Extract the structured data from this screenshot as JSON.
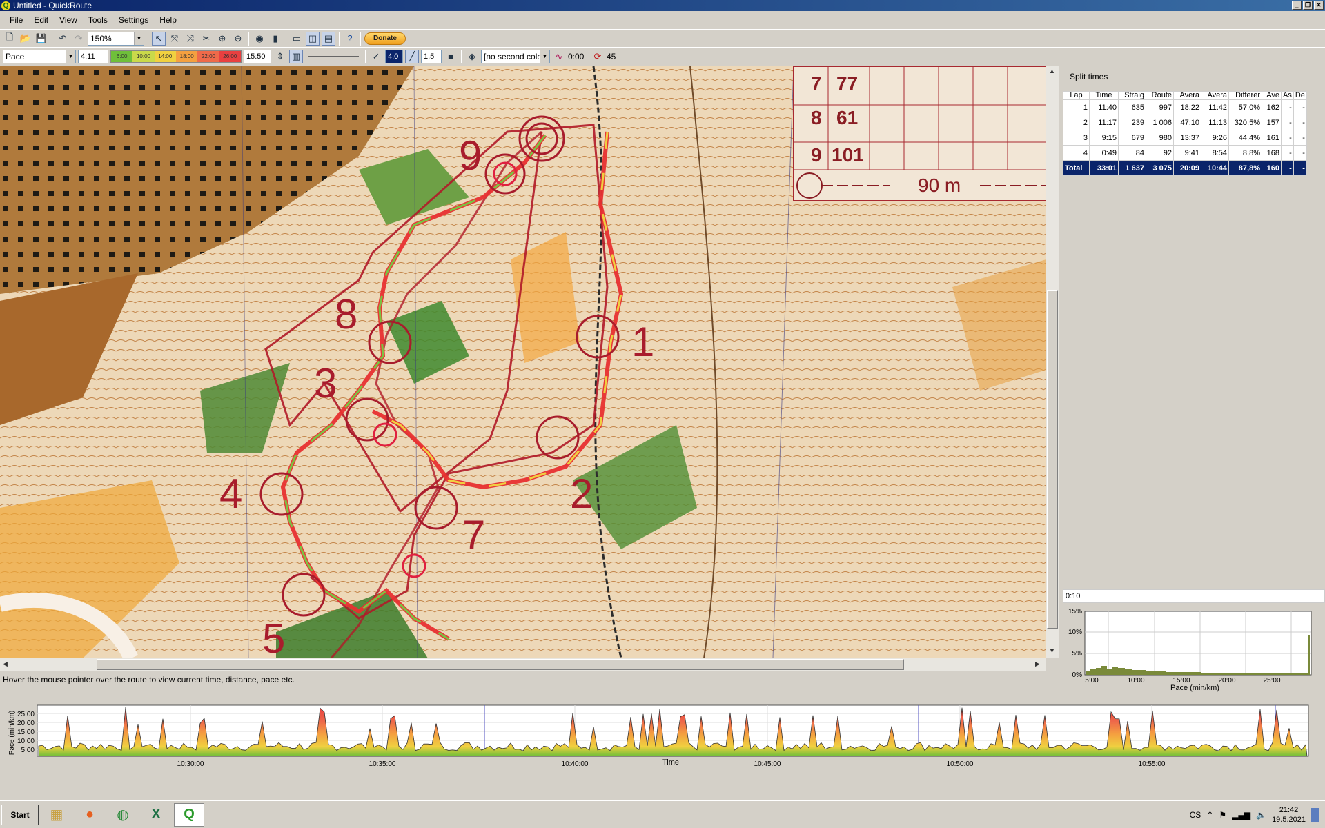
{
  "window": {
    "title": "Untitled - QuickRoute"
  },
  "menu": [
    "File",
    "Edit",
    "View",
    "Tools",
    "Settings",
    "Help"
  ],
  "toolbar": {
    "zoom": "150%",
    "donate": "Donate"
  },
  "toolbar2": {
    "property": "Pace",
    "min_value": "4:11",
    "scale_labels": [
      "6:00",
      "10:00",
      "14:00",
      "18:00",
      "22:00",
      "26:00"
    ],
    "max_value": "15:50",
    "width_value": "1,5",
    "second_color": "[no second color",
    "time_offset": "0:00",
    "smoothing": "45"
  },
  "map": {
    "legend_rows": [
      [
        "7",
        "77"
      ],
      [
        "8",
        "61"
      ],
      [
        "9",
        "101"
      ]
    ],
    "scale_text": "90 m",
    "controls": [
      "1",
      "2",
      "3",
      "4",
      "5",
      "7",
      "8",
      "9"
    ]
  },
  "status": "Hover the mouse pointer over the route to view current time, distance, pace etc.",
  "splits": {
    "title": "Split times",
    "headers": [
      "Lap",
      "Time",
      "Straig",
      "Route",
      "Avera",
      "Avera",
      "Differer",
      "Ave",
      "As",
      "De"
    ],
    "rows": [
      [
        "1",
        "11:40",
        "635",
        "997",
        "18:22",
        "11:42",
        "57,0%",
        "162",
        "-",
        "-"
      ],
      [
        "2",
        "11:17",
        "239",
        "1 006",
        "47:10",
        "11:13",
        "320,5%",
        "157",
        "-",
        "-"
      ],
      [
        "3",
        "9:15",
        "679",
        "980",
        "13:37",
        "9:26",
        "44,4%",
        "161",
        "-",
        "-"
      ],
      [
        "4",
        "0:49",
        "84",
        "92",
        "9:41",
        "8:54",
        "8,8%",
        "168",
        "-",
        "-"
      ]
    ],
    "total": [
      "Total",
      "33:01",
      "1 637",
      "3 075",
      "20:09",
      "10:44",
      "87,8%",
      "160",
      "-",
      "-"
    ]
  },
  "histogram": {
    "duration": "0:10",
    "y_ticks": [
      "15%",
      "10%",
      "5%",
      "0%"
    ],
    "x_ticks": [
      "5:00",
      "10:00",
      "15:00",
      "20:00",
      "25:00"
    ],
    "x_label": "Pace (min/km)"
  },
  "line_graph": {
    "y_label": "Pace (min/km)",
    "y_ticks": [
      "25:00",
      "20:00",
      "15:00",
      "10:00",
      "5:00"
    ],
    "x_ticks": [
      "10:30:00",
      "10:35:00",
      "10:40:00",
      "10:45:00",
      "10:50:00",
      "10:55:00"
    ],
    "x_label": "Time"
  },
  "taskbar": {
    "start": "Start",
    "lang": "CS",
    "time": "21:42",
    "date": "19.5.2021"
  },
  "colors": {
    "title_bar": "#0a246a",
    "selection": "#0a246a",
    "route_slow": "#e83030",
    "route_fast": "#7cc242"
  }
}
